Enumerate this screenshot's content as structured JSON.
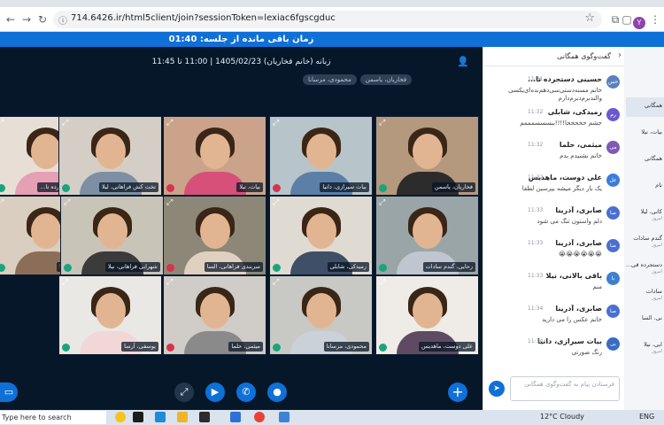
{
  "browser": {
    "url": "714.6426.ir/html5client/join?sessionToken=lexiac6fgscgduc",
    "profile_initial": "Y"
  },
  "banner": {
    "text": "زمان باقی مانده از جلسه: 01:40"
  },
  "meeting": {
    "title": "زبانه (خانم فخاریان) 1405/02/23 | 11:00 تا 11:45",
    "talkers": [
      "فخاریان، یاسمن",
      "محمودی، مرسانا"
    ]
  },
  "tiles": [
    {
      "name": "حسینی دستجرده تا...",
      "mic": "on"
    },
    {
      "name": "تخت کش فراهانی، لیلا",
      "mic": "on"
    },
    {
      "name": "بیات، نیلا",
      "mic": "off"
    },
    {
      "name": "بیات سیرازی، دانیا",
      "mic": "off"
    },
    {
      "name": "فخاریان، یاسمن",
      "mic": "on"
    },
    {
      "name": "صابری، آدرینا",
      "mic": "on"
    },
    {
      "name": "شهرابی فراهانی، نیلا",
      "mic": "on"
    },
    {
      "name": "سربندی فراهانی، السا",
      "mic": "off"
    },
    {
      "name": "رمیدکی، شابلی",
      "mic": "on"
    },
    {
      "name": "رحایی، گندم سادات",
      "mic": "on"
    },
    {
      "name": "یوسفی، آرسا",
      "mic": "on"
    },
    {
      "name": "میثمی، حلما",
      "mic": "off"
    },
    {
      "name": "محمودی، مرسانا",
      "mic": "on"
    },
    {
      "name": "علی دوست، ماهدیس",
      "mic": "on"
    }
  ],
  "chat": {
    "title": "گفت‌وگوی همگانی",
    "messages": [
      {
        "initials": "حس",
        "sender": "حسینی دستجرده تا...",
        "time": "11:31",
        "text": "خانم مسنه‌دستی‌سی‌دهم‌نده‌ای‌یکسی والندبرم‌دبرم‌دارم"
      },
      {
        "initials": "رم",
        "sender": "رمیدکی، شابلی",
        "time": "11:32",
        "text": "جشم حححححا!!!!ببسسسمممم"
      },
      {
        "initials": "می",
        "sender": "میثمی، حلما",
        "time": "11:32",
        "text": "خانم نشنیدم بدم"
      },
      {
        "initials": "عل",
        "sender": "علی دوست، ماهدیس",
        "time": "11:32",
        "text": "یک بار دیگر میشه بپرسین لطفا"
      },
      {
        "initials": "صا",
        "sender": "صابری، آدرینا",
        "time": "11:33",
        "text": "دلم واستون تنگ می شود"
      },
      {
        "initials": "صا",
        "sender": "صابری، آدرینا",
        "time": "11:33",
        "text": "😭😭😭😭😭😭"
      },
      {
        "initials": "با",
        "sender": "باقی بالانی، نیلا",
        "time": "11:33",
        "text": "منم"
      },
      {
        "initials": "صا",
        "sender": "صابری، آدرینا",
        "time": "11:34",
        "text": "خانم عکس را می دارید"
      },
      {
        "initials": "بی",
        "sender": "بیات سیرازی، دانیا",
        "time": "11:34",
        "text": "رنگ صورتی"
      }
    ],
    "input_placeholder": "فرستادن پیام به گفت‌وگوی همگانی"
  },
  "side": {
    "items": [
      {
        "label": "همگانی",
        "sub": ""
      },
      {
        "label": "بیات، نیلا",
        "sub": ""
      },
      {
        "label": "همگانی",
        "sub": ""
      },
      {
        "label": "نام",
        "sub": ""
      },
      {
        "label": "کانی، لیلا",
        "sub": "امروز"
      },
      {
        "label": "گندم سادات",
        "sub": "امروز"
      },
      {
        "label": "دستجرده قی...",
        "sub": "امروز"
      },
      {
        "label": "سادات",
        "sub": "امروز"
      },
      {
        "label": "نی، السا",
        "sub": ""
      },
      {
        "label": "ابی، نیلا",
        "sub": "امروز"
      }
    ]
  },
  "taskbar": {
    "search_text": "Type here to search",
    "weather": "12°C  Cloudy",
    "lang": "ENG"
  },
  "colors": {
    "primary": "#0f70d7",
    "video_bg": "#06172a",
    "mic_on": "#1aa47d",
    "mic_off": "#d6334c"
  }
}
